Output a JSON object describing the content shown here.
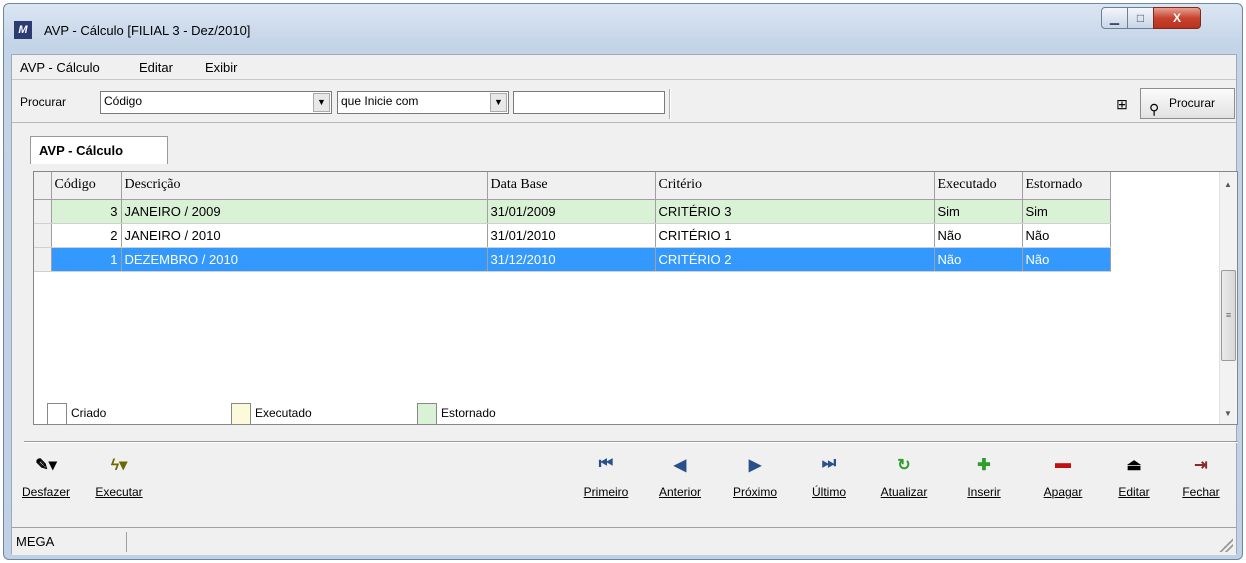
{
  "window": {
    "title": "AVP - Cálculo [FILIAL 3 - Dez/2010]",
    "icon": "app-logo-icon",
    "controls": {
      "minimize": "▁",
      "maximize": "□",
      "close": "X"
    }
  },
  "menu": [
    {
      "label": "AVP - Cálculo"
    },
    {
      "label": "Editar"
    },
    {
      "label": "Exibir"
    }
  ],
  "search": {
    "label": "Procurar",
    "field": "Código",
    "condition": "que Inicie com",
    "value": "",
    "button_label": "Procurar"
  },
  "tab": {
    "label": "AVP - Cálculo"
  },
  "grid": {
    "columns": [
      "Código",
      "Descrição",
      "Data Base",
      "Critério",
      "Executado",
      "Estornado"
    ],
    "rows": [
      {
        "codigo": "3",
        "descricao": "JANEIRO / 2009",
        "data_base": "31/01/2009",
        "criterio": "CRITÉRIO 3",
        "executado": "Sim",
        "estornado": "Sim",
        "status": "estornado"
      },
      {
        "codigo": "2",
        "descricao": "JANEIRO / 2010",
        "data_base": "31/01/2010",
        "criterio": "CRITÉRIO 1",
        "executado": "Não",
        "estornado": "Não",
        "status": "criado"
      },
      {
        "codigo": "1",
        "descricao": "DEZEMBRO / 2010",
        "data_base": "31/12/2010",
        "criterio": "CRITÉRIO 2",
        "executado": "Não",
        "estornado": "Não",
        "status": "selected"
      }
    ]
  },
  "legend": [
    {
      "label": "Criado",
      "color": "#ffffff"
    },
    {
      "label": "Executado",
      "color": "#fbfbdc"
    },
    {
      "label": "Estornado",
      "color": "#d9f2d5"
    }
  ],
  "toolbar": {
    "desfazer": "Desfazer",
    "executar": "Executar",
    "primeiro": "Primeiro",
    "anterior": "Anterior",
    "proximo": "Próximo",
    "ultimo": "Último",
    "atualizar": "Atualizar",
    "inserir": "Inserir",
    "apagar": "Apagar",
    "editar": "Editar",
    "fechar": "Fechar"
  },
  "status": {
    "company": "MEGA"
  }
}
